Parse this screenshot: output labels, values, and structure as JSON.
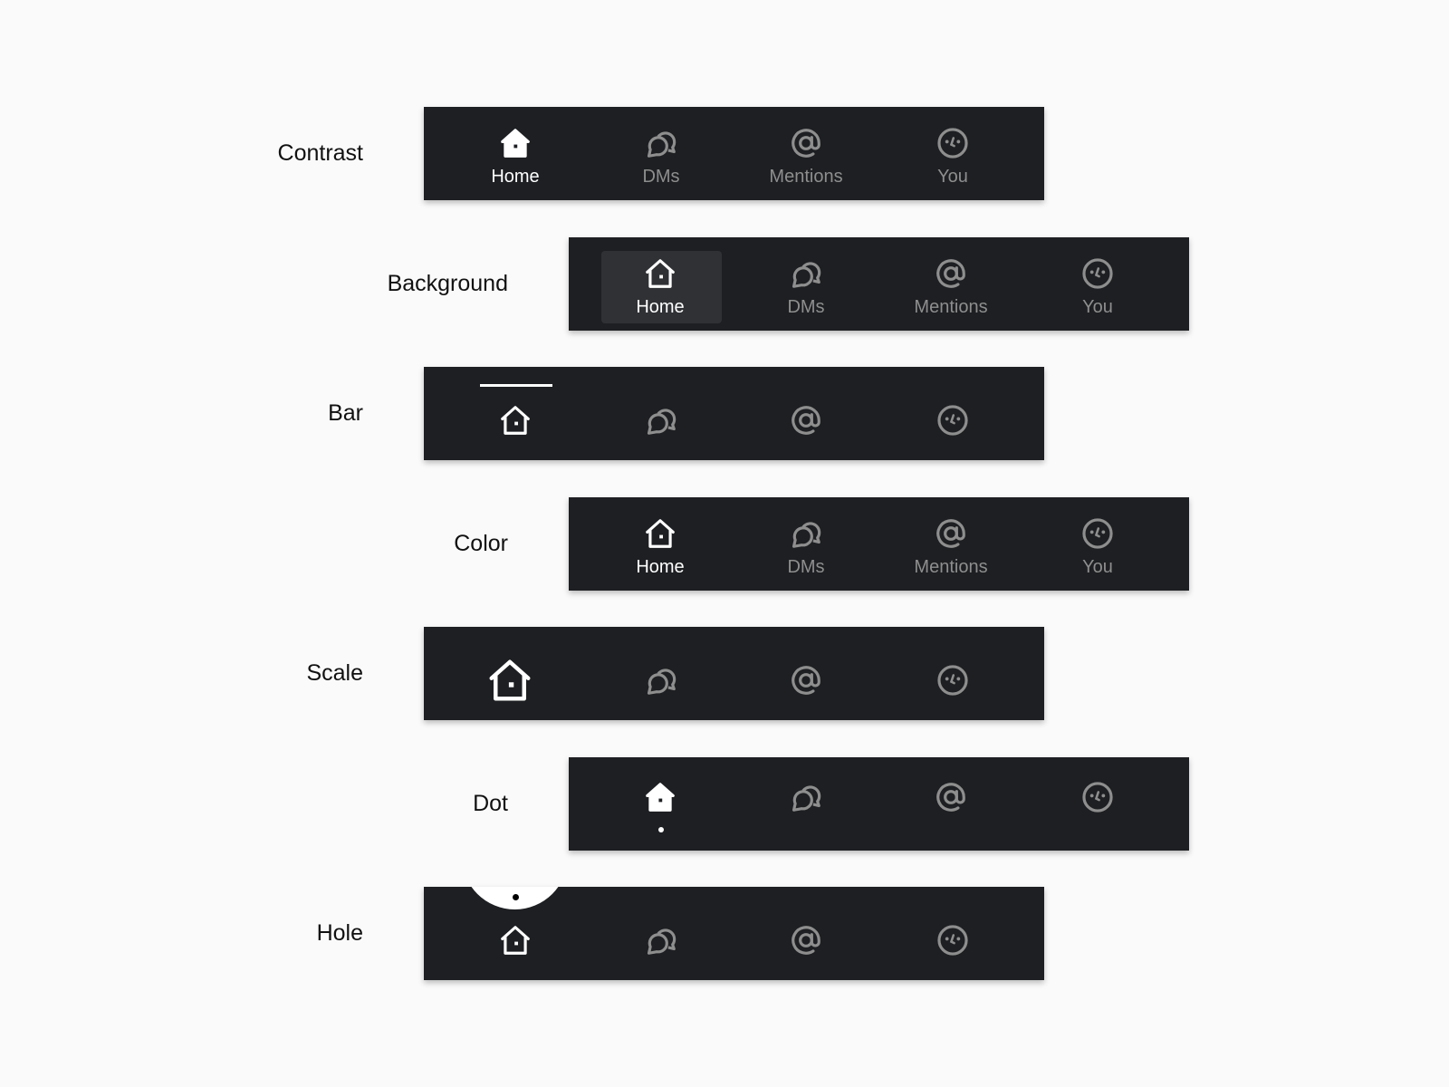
{
  "colors": {
    "page_bg": "#fafafa",
    "bar_bg": "#1d1f22",
    "active": "#ffffff",
    "inactive": "#8e8e8e",
    "highlight": "#2f3134"
  },
  "tabs": [
    {
      "label": "Home",
      "icon": "home-icon"
    },
    {
      "label": "DMs",
      "icon": "chat-bubbles-icon"
    },
    {
      "label": "Mentions",
      "icon": "at-sign-icon"
    },
    {
      "label": "You",
      "icon": "smiley-face-icon"
    }
  ],
  "rows": [
    {
      "label": "Contrast",
      "show_labels": true
    },
    {
      "label": "Background",
      "show_labels": true
    },
    {
      "label": "Bar",
      "show_labels": false
    },
    {
      "label": "Color",
      "show_labels": true
    },
    {
      "label": "Scale",
      "show_labels": false
    },
    {
      "label": "Dot",
      "show_labels": false
    },
    {
      "label": "Hole",
      "show_labels": false
    }
  ]
}
